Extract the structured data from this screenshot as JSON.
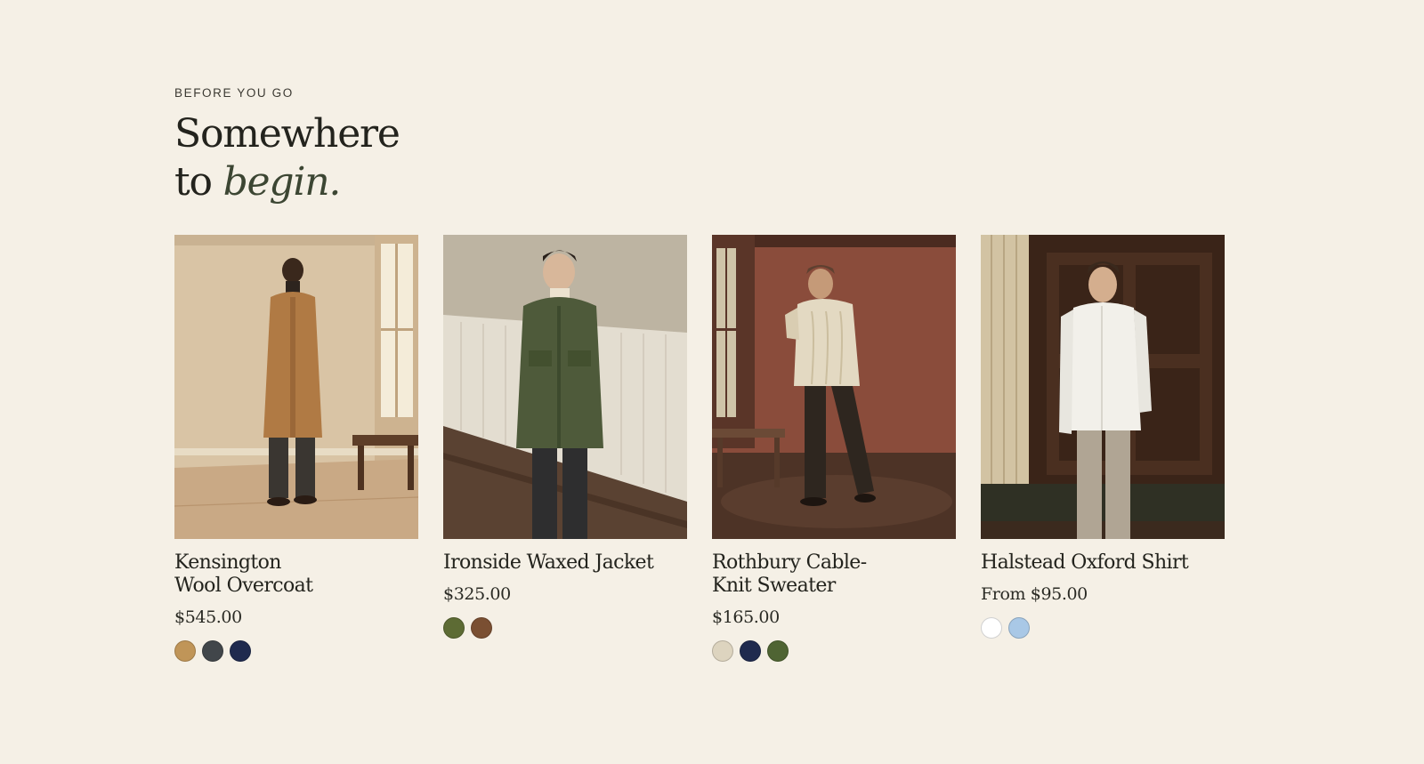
{
  "section": {
    "eyebrow": "BEFORE YOU GO",
    "heading_line1": "Somewhere",
    "heading_line2_plain": "to ",
    "heading_line2_em": "begin."
  },
  "products": [
    {
      "name": "Kensington\nWool Overcoat",
      "price": "$545.00",
      "swatches": [
        "#c09558",
        "#41464a",
        "#1f2a4e"
      ]
    },
    {
      "name": "Ironside Waxed Jacket",
      "price": "$325.00",
      "swatches": [
        "#5d6b34",
        "#7a4f32"
      ]
    },
    {
      "name": "Rothbury Cable-\nKnit Sweater",
      "price": "$165.00",
      "swatches": [
        "#ddd4bf",
        "#1f2a4e",
        "#4f6433"
      ]
    },
    {
      "name": "Halstead Oxford Shirt",
      "price": "From $95.00",
      "swatches": [
        "#ffffff",
        "#a9c8e6"
      ]
    }
  ]
}
